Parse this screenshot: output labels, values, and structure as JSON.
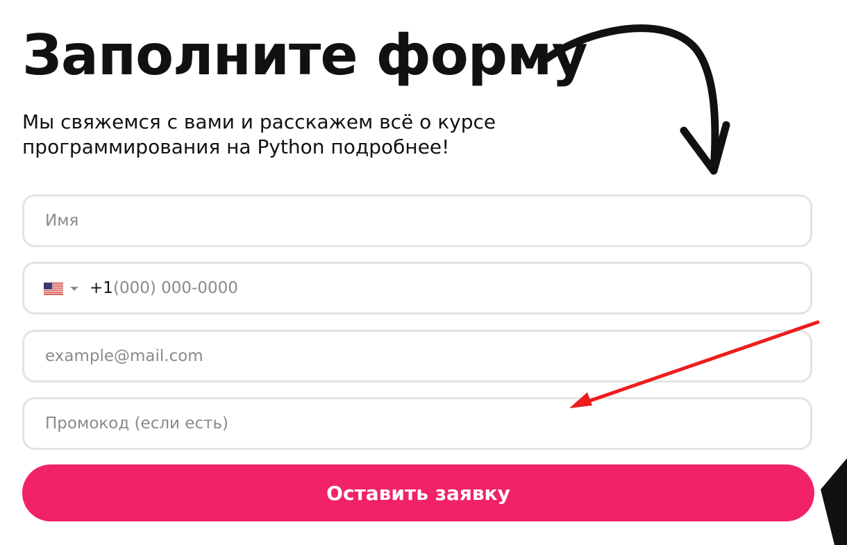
{
  "form": {
    "title": "Заполните форму",
    "subtitle": "Мы свяжемся с вами и расскажем всё о курсе программирования на Python подробнее!",
    "fields": {
      "name": {
        "placeholder": "Имя",
        "value": ""
      },
      "phone": {
        "country": "US",
        "flag_icon": "us-flag-icon",
        "dial_code": "+1",
        "placeholder": "(000) 000-0000",
        "value": ""
      },
      "email": {
        "placeholder": "example@mail.com",
        "value": ""
      },
      "promo": {
        "placeholder": "Промокод (если есть)",
        "value": ""
      }
    },
    "submit_label": "Оставить заявку"
  },
  "colors": {
    "accent": "#f22266",
    "field_border": "#e3e3e3",
    "annotation_arrow": "#ee1c1c",
    "text": "#111111",
    "placeholder": "#8a8a8a"
  }
}
